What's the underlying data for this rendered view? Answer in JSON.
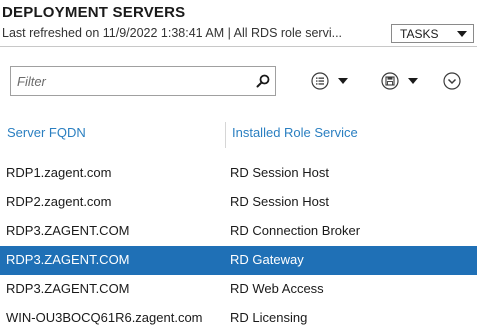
{
  "header": {
    "title": "DEPLOYMENT SERVERS",
    "subtitle": "Last refreshed on 11/9/2022 1:38:41 AM | All RDS role servi...",
    "tasks_label": "TASKS"
  },
  "filter": {
    "placeholder": "Filter",
    "value": ""
  },
  "toolbar": {
    "icons": [
      "search-icon",
      "list-options-icon",
      "save-query-icon",
      "expand-chevron-icon"
    ]
  },
  "table": {
    "columns": [
      "Server FQDN",
      "Installed Role Service"
    ],
    "rows": [
      {
        "fqdn": "RDP1.zagent.com",
        "role": "RD Session Host",
        "selected": false
      },
      {
        "fqdn": "RDP2.zagent.com",
        "role": "RD Session Host",
        "selected": false
      },
      {
        "fqdn": "RDP3.ZAGENT.COM",
        "role": "RD Connection Broker",
        "selected": false
      },
      {
        "fqdn": "RDP3.ZAGENT.COM",
        "role": "RD Gateway",
        "selected": true
      },
      {
        "fqdn": "RDP3.ZAGENT.COM",
        "role": "RD Web Access",
        "selected": false
      },
      {
        "fqdn": "WIN-OU3BOCQ61R6.zagent.com",
        "role": "RD Licensing",
        "selected": false
      }
    ]
  },
  "colors": {
    "accent": "#2a7fc1",
    "selection": "#1f70b6"
  }
}
